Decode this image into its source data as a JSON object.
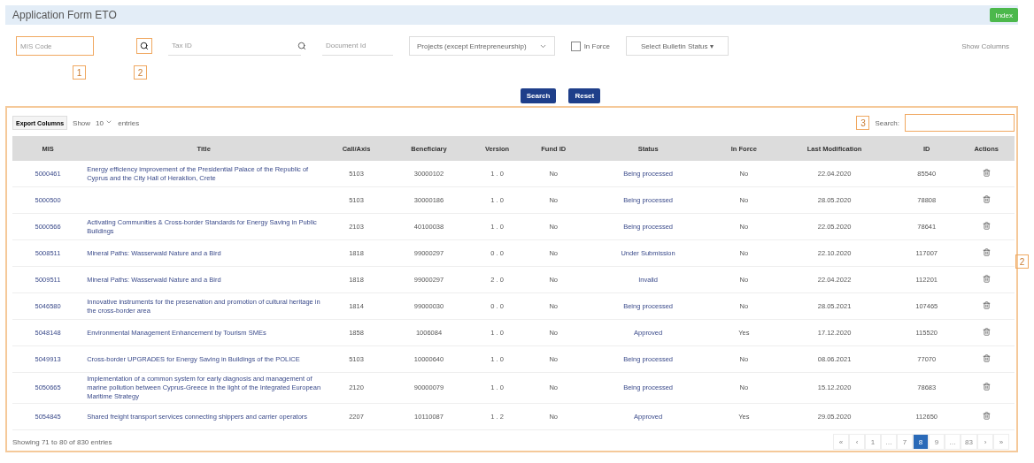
{
  "header": {
    "title": "Application Form ETO",
    "button": "Index"
  },
  "filters": {
    "mis": {
      "placeholder": "MIS Code"
    },
    "tax": {
      "placeholder": "Tax ID"
    },
    "document": {
      "placeholder": "Document Id"
    },
    "select": "Projects (except Entrepreneurship)",
    "in_force": {
      "label": "In Force",
      "checked": false
    },
    "status_button": "Select Bulletin Status ▾",
    "show_columns": "Show Columns",
    "markers": [
      "1",
      "2"
    ]
  },
  "actions": {
    "search": "Search",
    "reset": "Reset"
  },
  "table_panel": {
    "export": "Export Columns",
    "show": "Show",
    "length": "10",
    "entries": "entries",
    "marker": "3",
    "side_marker": "2",
    "search_label": "Search:",
    "columns": [
      "MIS",
      "Title",
      "Call/Axis",
      "Beneficiary",
      "Version",
      "Fund ID",
      "Status",
      "In Force",
      "Last Modification",
      "ID",
      "Actions"
    ],
    "rows": [
      {
        "mis": "5000461",
        "title": "Energy efficiency improvement of the Presidential Palace of the Republic of Cyprus and the City Hall of Heraklion, Crete",
        "call": "5103",
        "beneficiary": "30000102",
        "version": "1 . 0",
        "fund": "No",
        "status": "Being processed",
        "in_force": "No",
        "modified": "22.04.2020",
        "id": "85540"
      },
      {
        "mis": "5000500",
        "title": "",
        "call": "5103",
        "beneficiary": "30000186",
        "version": "1 . 0",
        "fund": "No",
        "status": "Being processed",
        "in_force": "No",
        "modified": "28.05.2020",
        "id": "78808"
      },
      {
        "mis": "5000566",
        "title": "Activating Communities & Cross-border Standards for Energy Saving in Public Buildings",
        "call": "2103",
        "beneficiary": "40100038",
        "version": "1 . 0",
        "fund": "No",
        "status": "Being processed",
        "in_force": "No",
        "modified": "22.05.2020",
        "id": "78641"
      },
      {
        "mis": "5008511",
        "title": "Mineral Paths: Wasserwald Nature and a Bird",
        "call": "1818",
        "beneficiary": "99000297",
        "version": "0 . 0",
        "fund": "No",
        "status": "Under Submission",
        "in_force": "No",
        "modified": "22.10.2020",
        "id": "117007"
      },
      {
        "mis": "5009511",
        "title": "Mineral Paths: Wasserwald Nature and a Bird",
        "call": "1818",
        "beneficiary": "99000297",
        "version": "2 . 0",
        "fund": "No",
        "status": "Invalid",
        "in_force": "No",
        "modified": "22.04.2022",
        "id": "112201"
      },
      {
        "mis": "5046580",
        "title": "Innovative instruments for the preservation and promotion of cultural heritage in the cross-border area",
        "call": "1814",
        "beneficiary": "99000030",
        "version": "0 . 0",
        "fund": "No",
        "status": "Being processed",
        "in_force": "No",
        "modified": "28.05.2021",
        "id": "107465"
      },
      {
        "mis": "5048148",
        "title": "Environmental Management Enhancement by Tourism SMEs",
        "call": "1858",
        "beneficiary": "1006084",
        "version": "1 . 0",
        "fund": "No",
        "status": "Approved",
        "in_force": "Yes",
        "modified": "17.12.2020",
        "id": "115520"
      },
      {
        "mis": "5049913",
        "title": "Cross-border UPGRADES for Energy Saving in Buildings of the POLICE",
        "call": "5103",
        "beneficiary": "10000640",
        "version": "1 . 0",
        "fund": "No",
        "status": "Being processed",
        "in_force": "No",
        "modified": "08.06.2021",
        "id": "77070"
      },
      {
        "mis": "5050665",
        "title": "Implementation of a common system for early diagnosis and management of marine pollution between Cyprus-Greece in the light of the Integrated European Maritime Strategy",
        "call": "2120",
        "beneficiary": "90000079",
        "version": "1 . 0",
        "fund": "No",
        "status": "Being processed",
        "in_force": "No",
        "modified": "15.12.2020",
        "id": "78683"
      },
      {
        "mis": "5054845",
        "title": "Shared freight transport services connecting shippers and carrier operators",
        "call": "2207",
        "beneficiary": "10110087",
        "version": "1 . 2",
        "fund": "No",
        "status": "Approved",
        "in_force": "Yes",
        "modified": "29.05.2020",
        "id": "112650"
      }
    ],
    "info": "Showing 71 to 80 of 830 entries",
    "pages": [
      {
        "label": "«",
        "selected": false
      },
      {
        "label": "‹",
        "selected": false
      },
      {
        "label": "1",
        "selected": false
      },
      {
        "label": "…",
        "selected": false
      },
      {
        "label": "7",
        "selected": false
      },
      {
        "label": "8",
        "selected": true
      },
      {
        "label": "9",
        "selected": false
      },
      {
        "label": "…",
        "selected": false
      },
      {
        "label": "83",
        "selected": false
      },
      {
        "label": "›",
        "selected": false
      },
      {
        "label": "»",
        "selected": false
      }
    ]
  }
}
